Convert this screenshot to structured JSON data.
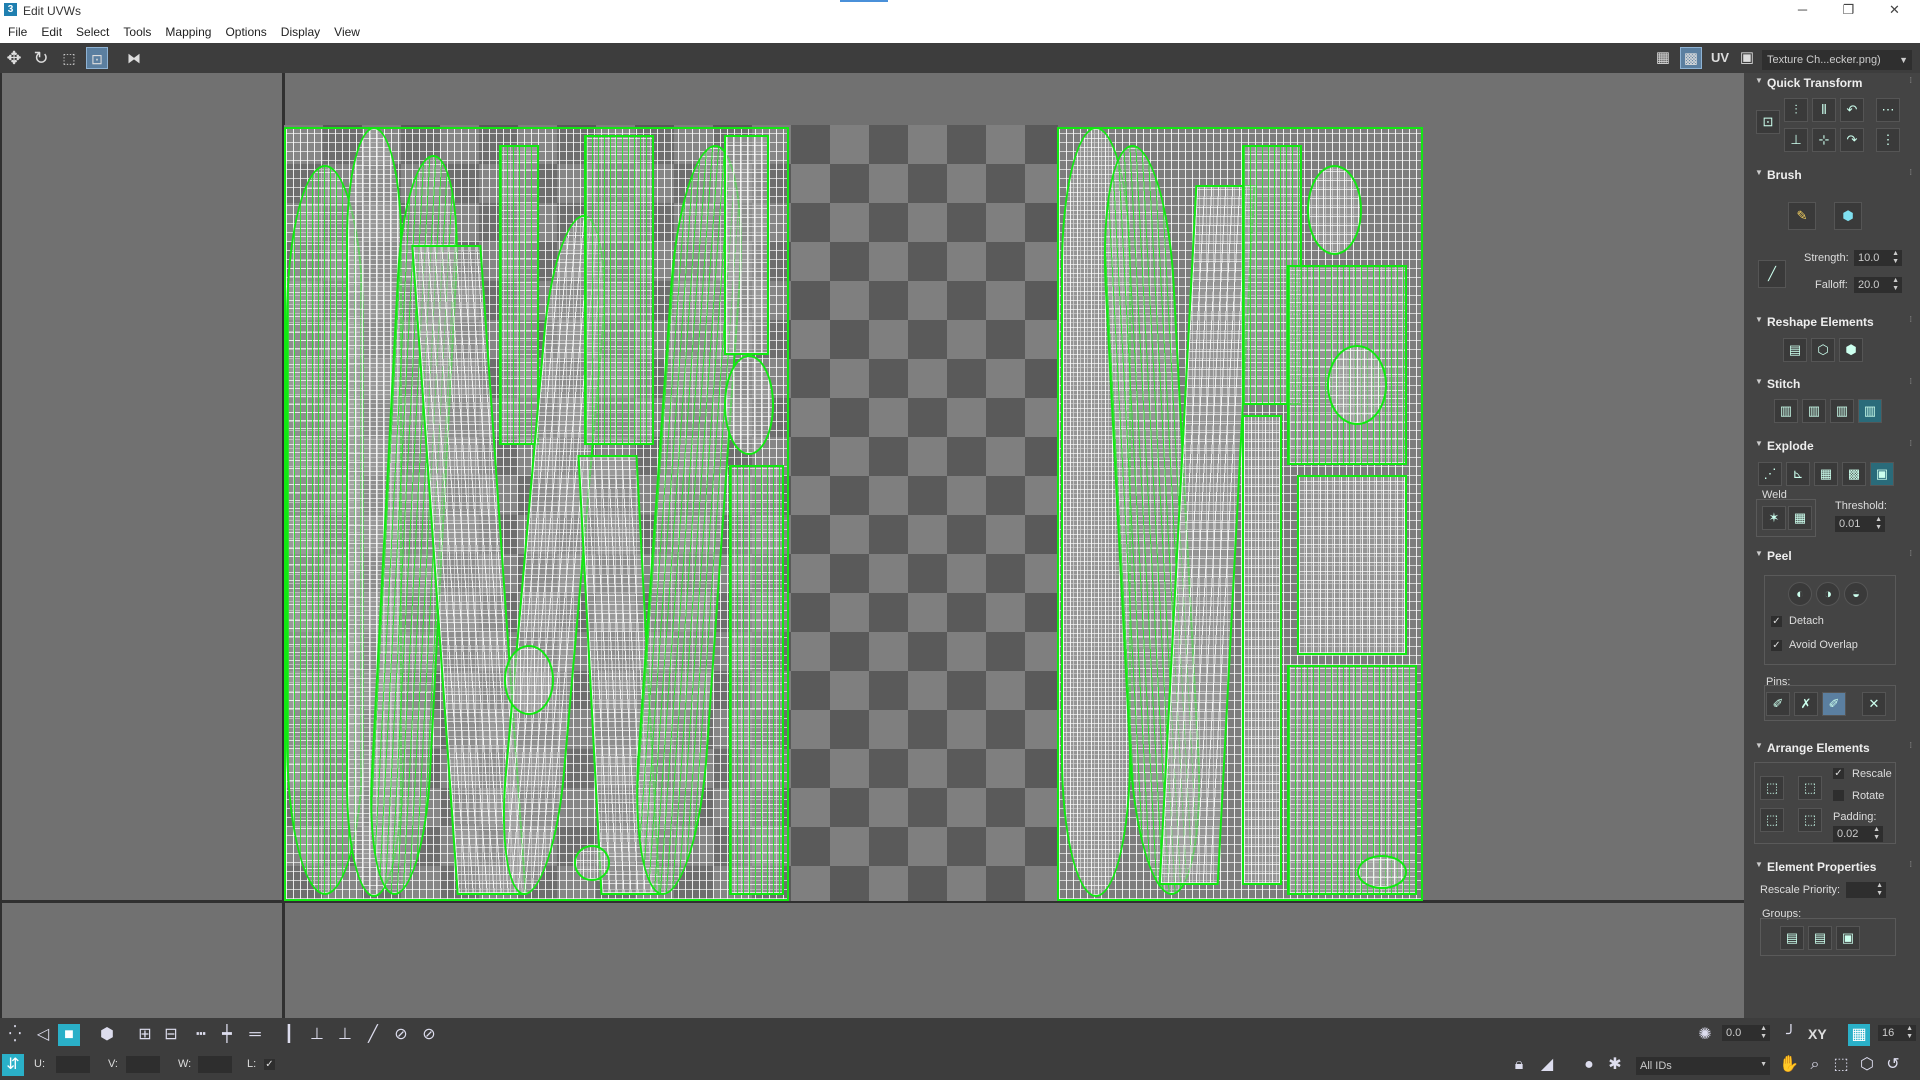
{
  "window": {
    "title": "Edit UVWs",
    "app_icon": "3",
    "minimize_icon": "─",
    "restore_icon": "❐",
    "close_icon": "✕"
  },
  "menu": [
    "File",
    "Edit",
    "Select",
    "Tools",
    "Mapping",
    "Options",
    "Display",
    "View"
  ],
  "toolbar": {
    "uv_label": "UV",
    "texture_selector": "Texture Ch...ecker.png)"
  },
  "panel": {
    "quick_transform": {
      "title": "Quick Transform"
    },
    "brush": {
      "title": "Brush",
      "strength_label": "Strength:",
      "strength_value": "10.0",
      "falloff_label": "Falloff:",
      "falloff_value": "20.0"
    },
    "reshape": {
      "title": "Reshape Elements"
    },
    "stitch": {
      "title": "Stitch"
    },
    "explode": {
      "title": "Explode",
      "weld_label": "Weld",
      "threshold_label": "Threshold:",
      "threshold_value": "0.01"
    },
    "peel": {
      "title": "Peel",
      "detach_label": "Detach",
      "detach_checked": true,
      "avoid_overlap_label": "Avoid Overlap",
      "avoid_overlap_checked": true,
      "pins_label": "Pins:"
    },
    "arrange": {
      "title": "Arrange Elements",
      "rescale_label": "Rescale",
      "rescale_checked": true,
      "rotate_label": "Rotate",
      "rotate_checked": false,
      "padding_label": "Padding:",
      "padding_value": "0.02"
    },
    "element_props": {
      "title": "Element Properties",
      "rescale_priority_label": "Rescale Priority:",
      "groups_label": "Groups:"
    }
  },
  "bottom": {
    "u_label": "U:",
    "v_label": "V:",
    "w_label": "W:",
    "l_label": "L:",
    "angle_value": "0.0",
    "xy_label": "XY",
    "grid_value": "16",
    "ids_dropdown": "All IDs"
  },
  "colors": {
    "seam_green": "#12e812",
    "panel_bg": "#444444",
    "viewport_bg": "#717171"
  }
}
